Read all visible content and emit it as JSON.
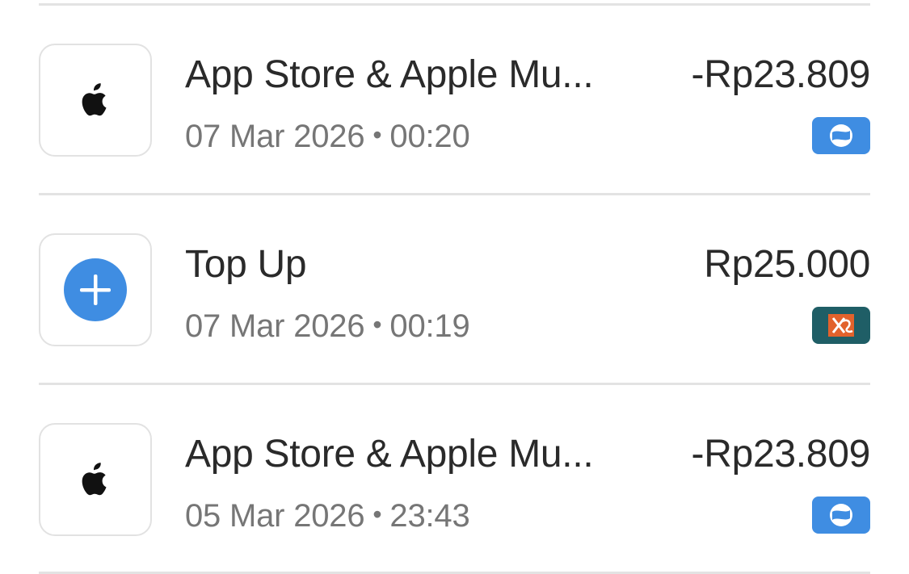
{
  "transactions": [
    {
      "title": "App Store & Apple Mu...",
      "date": "07 Mar 2026",
      "separator": "•",
      "time": "00:20",
      "amount": "-Rp23.809",
      "icon": "apple-logo-icon",
      "badge": "blue-wallet-badge-icon"
    },
    {
      "title": "Top Up",
      "date": "07 Mar 2026",
      "separator": "•",
      "time": "00:19",
      "amount": "Rp25.000",
      "icon": "plus-circle-icon",
      "badge": "bank-logo-badge-icon"
    },
    {
      "title": "App Store & Apple Mu...",
      "date": "05 Mar 2026",
      "separator": "•",
      "time": "23:43",
      "amount": "-Rp23.809",
      "icon": "apple-logo-icon",
      "badge": "blue-wallet-badge-icon"
    }
  ],
  "colors": {
    "accent_blue": "#3f8de2",
    "bank_teal": "#1f5e66",
    "bank_orange": "#e2622c",
    "text_primary": "#2a2a2a",
    "text_secondary": "#767676",
    "divider": "#e3e3e3"
  }
}
